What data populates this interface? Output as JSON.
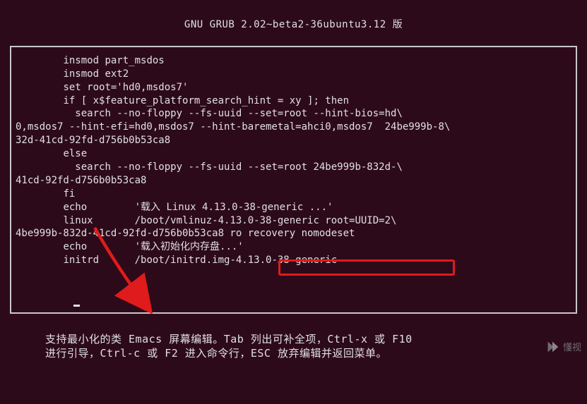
{
  "header": {
    "title": "GNU GRUB  2.02~beta2-36ubuntu3.12 版"
  },
  "editor": {
    "lines": [
      "        insmod part_msdos",
      "        insmod ext2",
      "        set root='hd0,msdos7'",
      "        if [ x$feature_platform_search_hint = xy ]; then",
      "          search --no-floppy --fs-uuid --set=root --hint-bios=hd\\",
      "0,msdos7 --hint-efi=hd0,msdos7 --hint-baremetal=ahci0,msdos7  24be999b-8\\",
      "32d-41cd-92fd-d756b0b53ca8",
      "        else",
      "          search --no-floppy --fs-uuid --set=root 24be999b-832d-\\",
      "41cd-92fd-d756b0b53ca8",
      "        fi",
      "        echo        '载入 Linux 4.13.0-38-generic ...'",
      "        linux       /boot/vmlinuz-4.13.0-38-generic root=UUID=2\\",
      "4be999b-832d-41cd-92fd-d756b0b53ca8 ro recovery nomodeset",
      "        echo        '载入初始化内存盘...'",
      "        initrd      /boot/initrd.img-4.13.0-38-generic"
    ],
    "highlighted_segment": "ro recovery nomodeset"
  },
  "help": {
    "line1": "支持最小化的类 Emacs 屏幕编辑。Tab 列出可补全项，Ctrl-x 或 F10",
    "line2": "进行引导，Ctrl-c 或 F2 进入命令行，ESC 放弃编辑并返回菜单。"
  },
  "watermark": {
    "text": "懂视"
  }
}
